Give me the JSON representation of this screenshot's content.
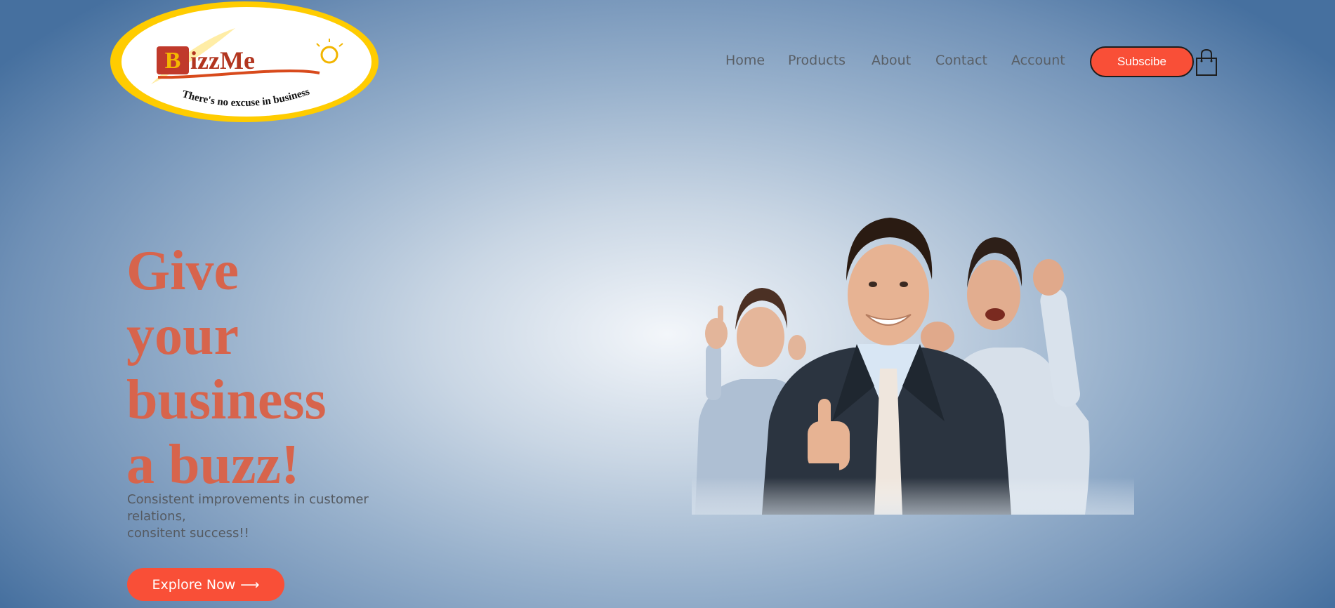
{
  "logo": {
    "brand": "BizzMe",
    "tagline": "There's no excuse in business"
  },
  "nav": {
    "items": [
      "Home",
      "Products",
      "About",
      "Contact",
      "Account"
    ],
    "subscribe_label": "Subscibe",
    "cart_icon": "shopping-bag-icon"
  },
  "hero": {
    "title_lines": [
      "Give",
      "your",
      "business",
      "a buzz!"
    ],
    "subtitle_lines": [
      "Consistent improvements in customer",
      "relations,",
      "consitent success!!"
    ],
    "cta_label": "Explore Now",
    "cta_icon": "arrow-right-icon"
  },
  "colors": {
    "accent": "#f94f37",
    "title": "#d7644c",
    "nav_text": "#595f66",
    "logo_ring": "#ffcc00"
  }
}
